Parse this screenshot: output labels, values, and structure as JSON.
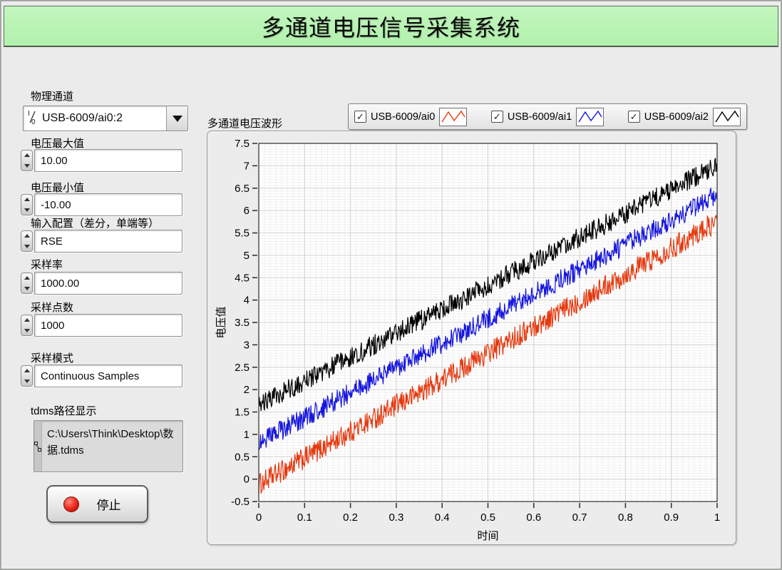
{
  "window": {
    "title": "多通道电压信号采集系统"
  },
  "controls": {
    "physical_channel": {
      "label": "物理通道",
      "value": "USB-6009/ai0:2",
      "io_icon": "io-type-icon"
    },
    "voltage_max": {
      "label": "电压最大值",
      "value": "10.00"
    },
    "voltage_min": {
      "label": "电压最小值",
      "value": "-10.00"
    },
    "input_config": {
      "label": "输入配置（差分，单端等）",
      "value": "RSE"
    },
    "sample_rate": {
      "label": "采样率",
      "value": "1000.00"
    },
    "sample_points": {
      "label": "采样点数",
      "value": "1000"
    },
    "sample_mode": {
      "label": "采样模式",
      "value": "Continuous Samples"
    },
    "tdms_path": {
      "label": "tdms路径显示",
      "value": "C:\\Users\\Think\\Desktop\\数据.tdms"
    },
    "stop_button": {
      "label": "停止",
      "led_color": "#e82417"
    }
  },
  "chart": {
    "title": "多通道电压波形"
  },
  "chart_data": {
    "type": "line",
    "title": "多通道电压波形",
    "xlabel": "时间",
    "ylabel": "电压值",
    "xlim": [
      0,
      1
    ],
    "ylim": [
      -0.5,
      7.5
    ],
    "x_tick_labels": [
      "0",
      "0.1",
      "0.2",
      "0.3",
      "0.4",
      "0.5",
      "0.6",
      "0.7",
      "0.8",
      "0.9",
      "1"
    ],
    "y_tick_labels": [
      "-0.5",
      "0",
      "0.5",
      "1",
      "1.5",
      "2",
      "2.5",
      "3",
      "3.5",
      "4",
      "4.5",
      "5",
      "5.5",
      "6",
      "6.5",
      "7",
      "7.5"
    ],
    "grid": true,
    "x_minor_step": 0.0125,
    "y_minor_step": 0.0625,
    "legend_position": "top-right",
    "series_model": "linear ramp start->end over x 0..1 plus uniform noise of given amplitude",
    "series": [
      {
        "name": "USB-6009/ai0",
        "color": "#e5390f",
        "checked": true,
        "start": -0.12,
        "end": 5.75,
        "noise": 0.25,
        "points": 800
      },
      {
        "name": "USB-6009/ai1",
        "color": "#1616dd",
        "checked": true,
        "start": 0.82,
        "end": 6.35,
        "noise": 0.23,
        "points": 800
      },
      {
        "name": "USB-6009/ai2",
        "color": "#000000",
        "checked": true,
        "start": 1.66,
        "end": 7.0,
        "noise": 0.23,
        "points": 800
      }
    ],
    "colors": {
      "plot_bg": "#ffffff",
      "grid_major": "#d2d2d2",
      "grid_minor": "#f0f0f0",
      "axis": "#2b2b2b"
    }
  }
}
